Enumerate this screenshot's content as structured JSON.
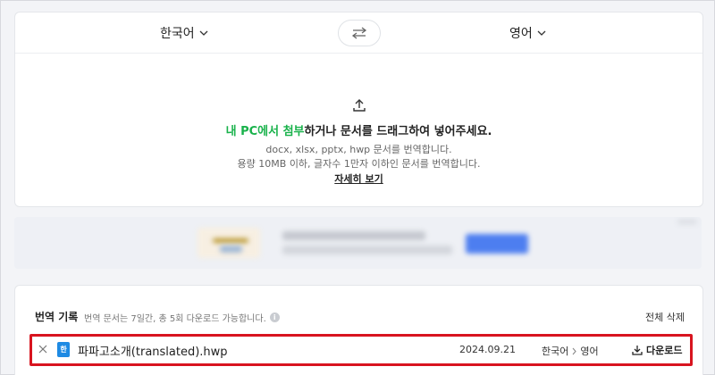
{
  "languages": {
    "source": "한국어",
    "target": "영어"
  },
  "upload": {
    "link_text": "내 PC에서 첨부",
    "rest_text": "하거나 문서를 드래그하여 넣어주세요.",
    "formats_text": "docx, xlsx, pptx, hwp 문서를 번역합니다.",
    "limit_text": "용량 10MB 이하, 글자수 1만자 이하인 문서를 번역합니다.",
    "details_link": "자세히 보기"
  },
  "history": {
    "title": "번역 기록",
    "note": "번역 문서는 7일간, 총 5회 다운로드 가능합니다.",
    "delete_all": "전체 삭제",
    "items": [
      {
        "file_badge": "한",
        "file_name": "파파고소개(translated).hwp",
        "date": "2024.09.21",
        "source_lang": "한국어",
        "target_lang": "영어",
        "download_label": "다운로드"
      }
    ]
  },
  "colors": {
    "accent_green": "#19b24b",
    "highlight_red": "#d8141f",
    "file_icon_blue": "#1e8ae3"
  }
}
